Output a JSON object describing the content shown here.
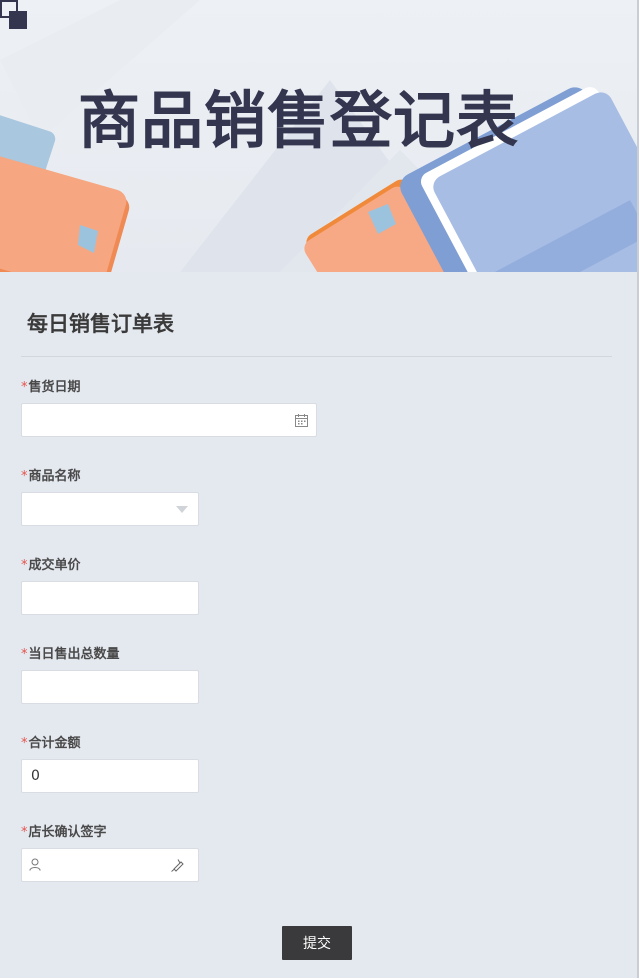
{
  "banner": {
    "title": "商品销售登记表"
  },
  "form": {
    "title": "每日销售订单表",
    "required_mark": "*",
    "fields": [
      {
        "label": "售货日期",
        "type": "date",
        "value": "",
        "icon": "calendar-icon"
      },
      {
        "label": "商品名称",
        "type": "select",
        "value": "",
        "icon": "dropdown-arrow-icon"
      },
      {
        "label": "成交单价",
        "type": "number",
        "value": ""
      },
      {
        "label": "当日售出总数量",
        "type": "number",
        "value": ""
      },
      {
        "label": "合计金额",
        "type": "number",
        "value": "0"
      },
      {
        "label": "店长确认签字",
        "type": "signature",
        "value": "",
        "icons": [
          "user-icon",
          "pen-icon"
        ]
      }
    ],
    "submit_label": "提交"
  },
  "colors": {
    "background": "#e4e8ef",
    "title_text": "#34354f",
    "required": "#e5534b",
    "submit_bg": "#3a3a3c"
  }
}
